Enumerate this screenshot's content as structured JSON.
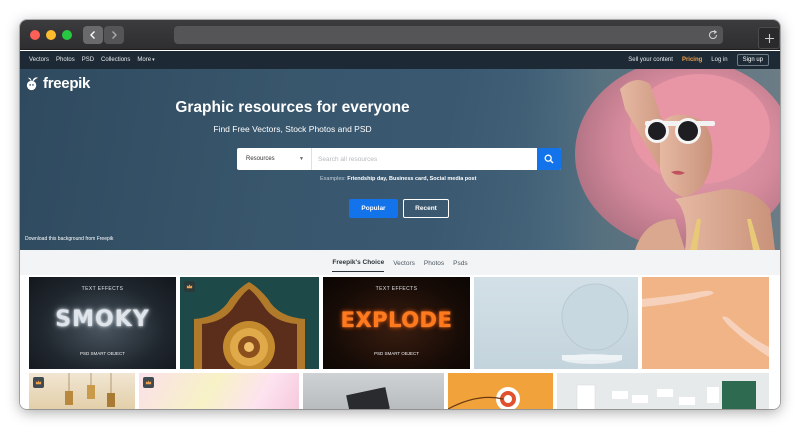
{
  "site_nav": {
    "left": [
      "Vectors",
      "Photos",
      "PSD",
      "Collections",
      "More"
    ],
    "sell": "Sell your content",
    "pricing": "Pricing",
    "login": "Log in",
    "signup": "Sign up"
  },
  "hero": {
    "logo_text": "freepik",
    "title": "Graphic resources for everyone",
    "subtitle": "Find Free Vectors, Stock Photos and PSD",
    "search": {
      "category": "Resources",
      "placeholder": "Search all resources"
    },
    "examples_label": "Examples:",
    "examples_links": "Friendship day, Business card, Social media post",
    "popular_button": "Popular",
    "recent_button": "Recent",
    "credit": "Download this background from Freepik"
  },
  "tabs": [
    "Freepik's Choice",
    "Vectors",
    "Photos",
    "Psds"
  ],
  "tiles": {
    "smoky": {
      "label": "TEXT EFFECTS",
      "word": "SMOKY",
      "caption": "PSD SMART OBJECT"
    },
    "explode": {
      "label": "TEXT EFFECTS",
      "word": "EXPLODE",
      "caption": "PSD SMART OBJECT"
    }
  },
  "colors": {
    "accent_blue": "#1273eb",
    "nav_bg": "#1d2a35",
    "pricing_orange": "#f0a14c"
  }
}
